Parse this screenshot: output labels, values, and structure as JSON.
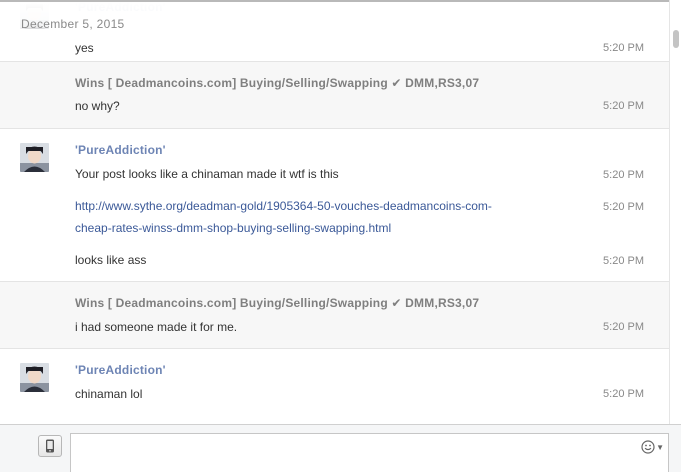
{
  "date_divider": "December 5, 2015",
  "messages": [
    {
      "sender": "'PureAddiction'",
      "lines": [
        {
          "text": "yes",
          "time": "5:20 PM"
        }
      ]
    },
    {
      "sender": "Wins [ Deadmancoins.com] Buying/Selling/Swapping ✔ DMM,RS3,07",
      "lines": [
        {
          "text": "no why?",
          "time": "5:20 PM"
        }
      ]
    },
    {
      "sender": "'PureAddiction'",
      "lines": [
        {
          "text": "Your post looks like a chinaman made it wtf is this",
          "time": "5:20 PM"
        },
        {
          "link_line1": "http://www.sythe.org/deadman-gold/1905364-50-vouches-deadmancoins-com-",
          "link_line2": "cheap-rates-winss-dmm-shop-buying-selling-swapping.html",
          "time": "5:20 PM"
        },
        {
          "text": "looks like ass",
          "time": "5:20 PM"
        }
      ]
    },
    {
      "sender": "Wins [ Deadmancoins.com] Buying/Selling/Swapping ✔ DMM,RS3,07",
      "lines": [
        {
          "text": "i had someone made it for me.",
          "time": "5:20 PM"
        }
      ]
    },
    {
      "sender": "'PureAddiction'",
      "lines": [
        {
          "text": "chinaman lol",
          "time": "5:20 PM"
        }
      ]
    }
  ],
  "composer": {
    "attach_icon": "mobile-icon",
    "emoji_icon": "smiley-icon",
    "reply_value": ""
  },
  "colors": {
    "sender_name": "#6d84b4",
    "link": "#3b5998",
    "alt_row": "#f7f7f7"
  }
}
